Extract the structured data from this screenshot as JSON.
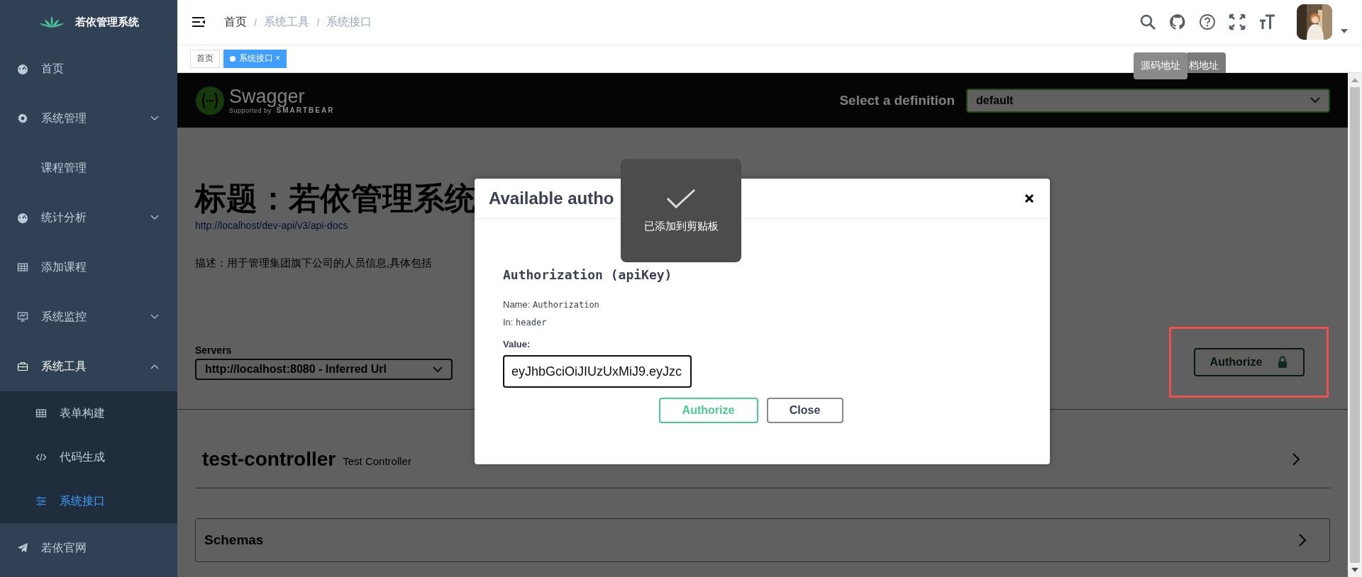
{
  "sidebar": {
    "title": "若依管理系统",
    "items": [
      {
        "kind": "item",
        "label": "首页",
        "selected": false
      },
      {
        "kind": "group",
        "label": "系统管理",
        "selected": false,
        "expanded": false
      },
      {
        "kind": "subitem",
        "label": "课程管理",
        "selected": false
      },
      {
        "kind": "group",
        "label": "统计分析",
        "selected": false,
        "expanded": false
      },
      {
        "kind": "item",
        "label": "添加课程",
        "selected": false
      },
      {
        "kind": "group",
        "label": "系统监控",
        "selected": false,
        "expanded": false
      },
      {
        "kind": "group",
        "label": "系统工具",
        "selected": false,
        "expanded": true,
        "children": [
          {
            "label": "表单构建",
            "selected": false
          },
          {
            "label": "代码生成",
            "selected": false
          },
          {
            "label": "系统接口",
            "selected": true
          }
        ]
      },
      {
        "kind": "item",
        "label": "若依官网",
        "selected": false
      }
    ]
  },
  "navbar": {
    "separator": "/",
    "breadcrumb": [
      {
        "label": "首页",
        "link": false
      },
      {
        "label": "系统工具",
        "link": true
      },
      {
        "label": "系统接口",
        "link": true
      }
    ],
    "tooltips": [
      "源码地址",
      "档地址"
    ]
  },
  "tags": [
    {
      "label": "首页",
      "selected": false
    },
    {
      "label": "系统接口",
      "selected": true,
      "close": "×"
    }
  ],
  "swagger": {
    "brand": "Swagger",
    "supported_by": "Supported by",
    "vendor": "SMARTBEAR",
    "definition_label": "Select a definition",
    "definition": "default",
    "title": "标题：若依管理系统",
    "url": "http://localhost/dev-api/v3/api-docs",
    "description": "描述：用于管理集团旗下公司的人员信息,具体包括",
    "servers_label": "Servers",
    "server": "http://localhost:8080 - Inferred Url",
    "authorize": "Authorize",
    "tags": [
      {
        "name": "test-controller",
        "description": "Test Controller",
        "expanded": false
      }
    ],
    "schemas": {
      "title": "Schemas",
      "expanded": false
    }
  },
  "modal": {
    "title": "Available autho",
    "scheme": "Authorization (apiKey)",
    "name_label": "Name:",
    "name": "Authorization",
    "in_label": "In:",
    "in": "header",
    "value_label": "Value:",
    "value": "eyJhbGciOiJIUzUxMiJ9.eyJzc",
    "buttons": [
      {
        "kind": "primary",
        "label": "Authorize"
      },
      {
        "kind": "secondary",
        "label": "Close"
      }
    ]
  },
  "toast": {
    "text": "已添加到剪贴板"
  }
}
